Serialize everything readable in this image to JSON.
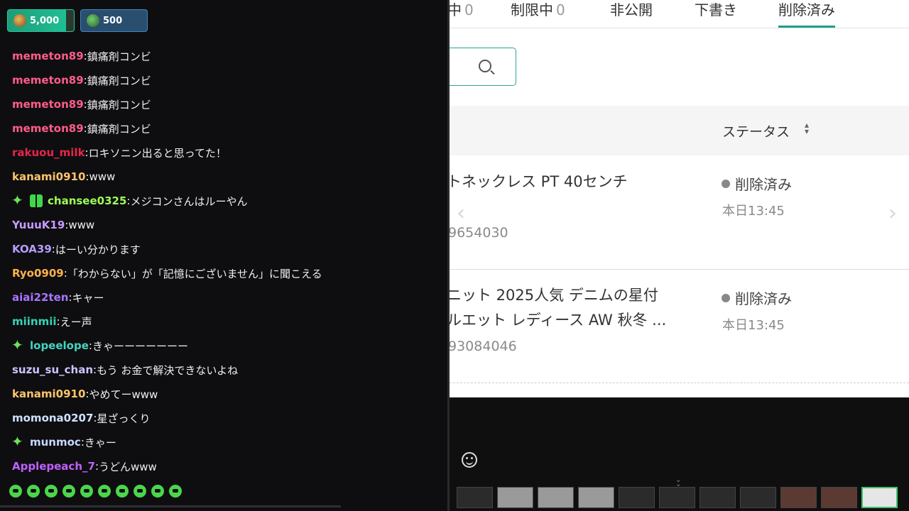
{
  "chat": {
    "points": [
      {
        "value": "5,000",
        "icon": "channel-points-icon"
      },
      {
        "value": "500",
        "icon": "prediction-points-icon"
      }
    ],
    "messages": [
      {
        "user": "memeton89",
        "color": "#ff5c8a",
        "text": "鎮痛剤コンビ",
        "badges": []
      },
      {
        "user": "memeton89",
        "color": "#ff5c8a",
        "text": "鎮痛剤コンビ",
        "badges": []
      },
      {
        "user": "memeton89",
        "color": "#ff5c8a",
        "text": "鎮痛剤コンビ",
        "badges": []
      },
      {
        "user": "memeton89",
        "color": "#ff5c8a",
        "text": "鎮痛剤コンビ",
        "badges": []
      },
      {
        "user": "rakuou_milk",
        "color": "#e8244a",
        "text": "ロキソニン出ると思ってた！",
        "badges": []
      },
      {
        "user": "kanami0910",
        "color": "#ffc46a",
        "text": "www",
        "badges": []
      },
      {
        "user": "chansee0325",
        "color": "#9dff59",
        "text": "メジコンさんはルーやん",
        "badges": [
          "sparkle-badge-icon",
          "gift-badge-icon"
        ]
      },
      {
        "user": "YuuuK19",
        "color": "#c79bff",
        "text": "www",
        "badges": []
      },
      {
        "user": "KOA39",
        "color": "#b69cff",
        "text": "はーい分かります",
        "badges": []
      },
      {
        "user": "Ryo0909",
        "color": "#ffb24a",
        "text": "「わからない」が「記憶にございません」に聞こえる",
        "badges": []
      },
      {
        "user": "aiai22ten",
        "color": "#a974ff",
        "text": "キャー",
        "badges": []
      },
      {
        "user": "miinmii",
        "color": "#35d3b5",
        "text": "えー声",
        "badges": []
      },
      {
        "user": "lopeelope",
        "color": "#44d4c0",
        "text": "きゃーーーーーーー",
        "badges": [
          "sparkle-badge-icon"
        ]
      },
      {
        "user": "suzu_su_chan",
        "color": "#cfc3ff",
        "text": "もう お金で解決できないよね",
        "badges": []
      },
      {
        "user": "kanami0910",
        "color": "#ffc46a",
        "text": "やめてーwww",
        "badges": []
      },
      {
        "user": "momona0207",
        "color": "#cfe1ff",
        "text": "星ざっくり",
        "badges": []
      },
      {
        "user": "munmoc",
        "color": "#c8d8ff",
        "text": "きゃー",
        "badges": [
          "sparkle-badge-icon"
        ]
      },
      {
        "user": "Applepeach_7",
        "color": "#c060ff",
        "text": "うどんwww",
        "badges": []
      }
    ],
    "emotes": [
      "emote-1",
      "emote-2",
      "emote-3",
      "emote-4",
      "emote-5",
      "emote-6",
      "emote-7",
      "emote-8",
      "emote-9",
      "emote-10"
    ]
  },
  "page": {
    "tabs": [
      {
        "label": "中",
        "count": "0"
      },
      {
        "label": "制限中",
        "count": "0"
      },
      {
        "label": "非公開",
        "count": ""
      },
      {
        "label": "下書き",
        "count": ""
      },
      {
        "label": "削除済み",
        "count": ""
      }
    ],
    "active_tab": 4,
    "table_header": {
      "status": "ステータス"
    },
    "rows": [
      {
        "title_lines": [
          "トネックレス PT 40センチ"
        ],
        "id": "9654030",
        "status": "削除済み",
        "time": "本日13:45"
      },
      {
        "title_lines": [
          "ニット 2025人気 デニムの星付",
          "ルエット レディース AW 秋冬 ..."
        ],
        "id": "93084046",
        "status": "削除済み",
        "time": "本日13:45"
      }
    ],
    "accent_color": "#1f9e8c"
  }
}
